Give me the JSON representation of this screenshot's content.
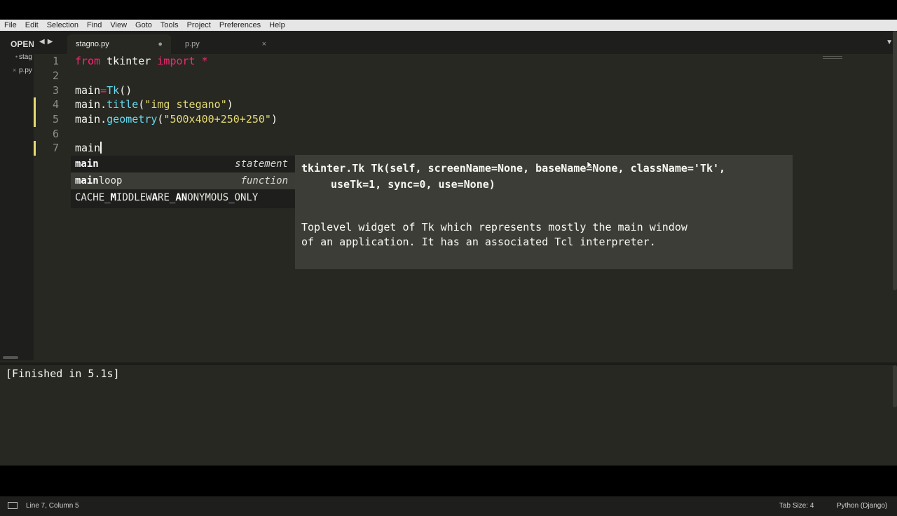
{
  "menu": [
    "File",
    "Edit",
    "Selection",
    "Find",
    "View",
    "Goto",
    "Tools",
    "Project",
    "Preferences",
    "Help"
  ],
  "sidebar": {
    "header": "OPEN",
    "files": [
      {
        "marker": "•",
        "name": "stag"
      },
      {
        "marker": "×",
        "name": "p.py"
      }
    ]
  },
  "tabs": [
    {
      "label": "stagno.py",
      "control": "●",
      "active": true
    },
    {
      "label": "p.py",
      "control": "×",
      "active": false
    }
  ],
  "editor": {
    "line_numbers": [
      "1",
      "2",
      "3",
      "4",
      "5",
      "6",
      "7"
    ],
    "lines": [
      {
        "text": "from tkinter import *"
      },
      {
        "text": ""
      },
      {
        "text": "main=Tk()"
      },
      {
        "text": "main.title(\"img stegano\")"
      },
      {
        "text": "main.geometry(\"500x400+250+250\")"
      },
      {
        "text": ""
      },
      {
        "text": "main"
      }
    ]
  },
  "autocomplete": [
    {
      "name": "main",
      "kind": "statement"
    },
    {
      "name": "mainloop",
      "kind": "function"
    },
    {
      "name": "CACHE_MIDDLEWARE_ANONYMOUS_ONLY",
      "kind": ""
    }
  ],
  "signature_popup": {
    "signature_line1": "tkinter.Tk Tk(self, screenName=None, baseName=None, className='Tk',",
    "signature_line2": "useTk=1, sync=0, use=None)",
    "doc_line1": "Toplevel widget of Tk which represents mostly the main window",
    "doc_line2": "of an application. It has an associated Tcl interpreter."
  },
  "output": {
    "text": "[Finished in 5.1s]"
  },
  "status": {
    "position": "Line 7, Column 5",
    "tab_size": "Tab Size: 4",
    "syntax": "Python (Django)"
  },
  "colors": {
    "background": "#272822",
    "keyword": "#f92672",
    "function": "#66d9ef",
    "string": "#e6db74",
    "foreground": "#f8f8f2"
  }
}
